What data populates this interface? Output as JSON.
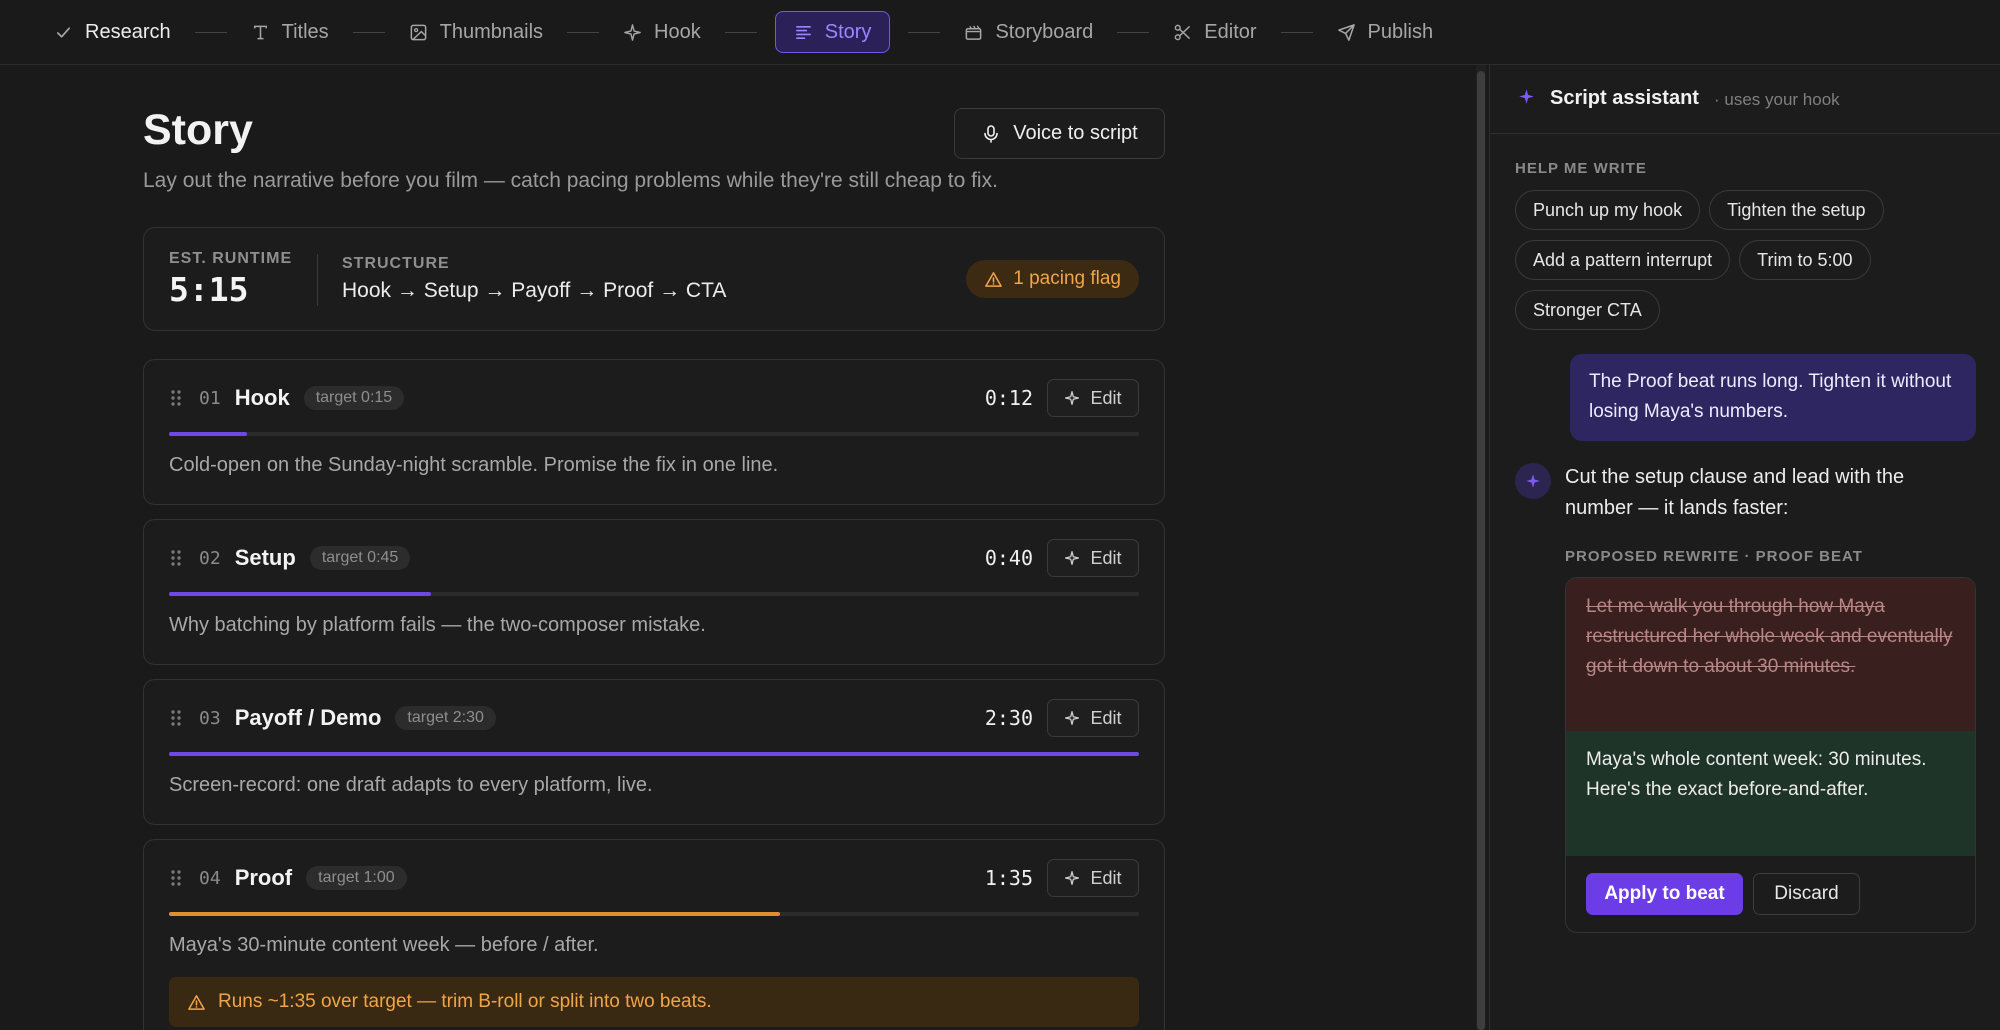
{
  "nav": {
    "steps": [
      {
        "label": "Research",
        "icon": "check-icon"
      },
      {
        "label": "Titles",
        "icon": "type-icon"
      },
      {
        "label": "Thumbnails",
        "icon": "image-icon"
      },
      {
        "label": "Hook",
        "icon": "sparkle-icon"
      },
      {
        "label": "Story",
        "icon": "text-lines-icon"
      },
      {
        "label": "Storyboard",
        "icon": "clapperboard-icon"
      },
      {
        "label": "Editor",
        "icon": "scissors-icon"
      },
      {
        "label": "Publish",
        "icon": "send-icon"
      }
    ],
    "active": "Story"
  },
  "page": {
    "title": "Story",
    "subtitle": "Lay out the narrative before you film — catch pacing problems while they're still cheap to fix.",
    "voice_button": "Voice to script"
  },
  "summary": {
    "runtime_label": "EST. RUNTIME",
    "runtime": "5:15",
    "structure_label": "STRUCTURE",
    "structure": "Hook → Setup → Payoff → Proof → CTA",
    "pacing_flag": "1 pacing flag"
  },
  "beats": [
    {
      "num": "01",
      "name": "Hook",
      "target": "target 0:15",
      "time": "0:12",
      "progress": 0.08,
      "status": "ok",
      "desc": "Cold-open on the Sunday-night scramble. Promise the fix in one line.",
      "edit": "Edit"
    },
    {
      "num": "02",
      "name": "Setup",
      "target": "target 0:45",
      "time": "0:40",
      "progress": 0.27,
      "status": "ok",
      "desc": "Why batching by platform fails — the two-composer mistake.",
      "edit": "Edit"
    },
    {
      "num": "03",
      "name": "Payoff / Demo",
      "target": "target 2:30",
      "time": "2:30",
      "progress": 1.0,
      "status": "ok",
      "desc": "Screen-record: one draft adapts to every platform, live.",
      "edit": "Edit"
    },
    {
      "num": "04",
      "name": "Proof",
      "target": "target 1:00",
      "time": "1:35",
      "progress": 0.63,
      "status": "warn",
      "desc": "Maya's 30-minute content week — before / after.",
      "edit": "Edit",
      "warning": "Runs ~1:35 over target — trim B-roll or split into two beats."
    }
  ],
  "assistant": {
    "title": "Script assistant",
    "subtitle": "· uses your hook",
    "help_label": "HELP ME WRITE",
    "chips": [
      "Punch up my hook",
      "Tighten the setup",
      "Add a pattern interrupt",
      "Trim to 5:00",
      "Stronger CTA"
    ],
    "user_message": "The Proof beat runs long. Tighten it without losing Maya's numbers.",
    "assistant_message": "Cut the setup clause and lead with the number — it lands faster:",
    "rewrite_label": "PROPOSED REWRITE · PROOF BEAT",
    "old_text": "Let me walk you through how Maya restructured her whole week and eventually got it down to about 30 minutes.",
    "new_text": "Maya's whole content week: 30 minutes. Here's the exact before-and-after.",
    "apply": "Apply to beat",
    "discard": "Discard"
  },
  "colors": {
    "accent": "#6d4ae8",
    "warning": "#e08e33",
    "background": "#1a1a1a"
  }
}
